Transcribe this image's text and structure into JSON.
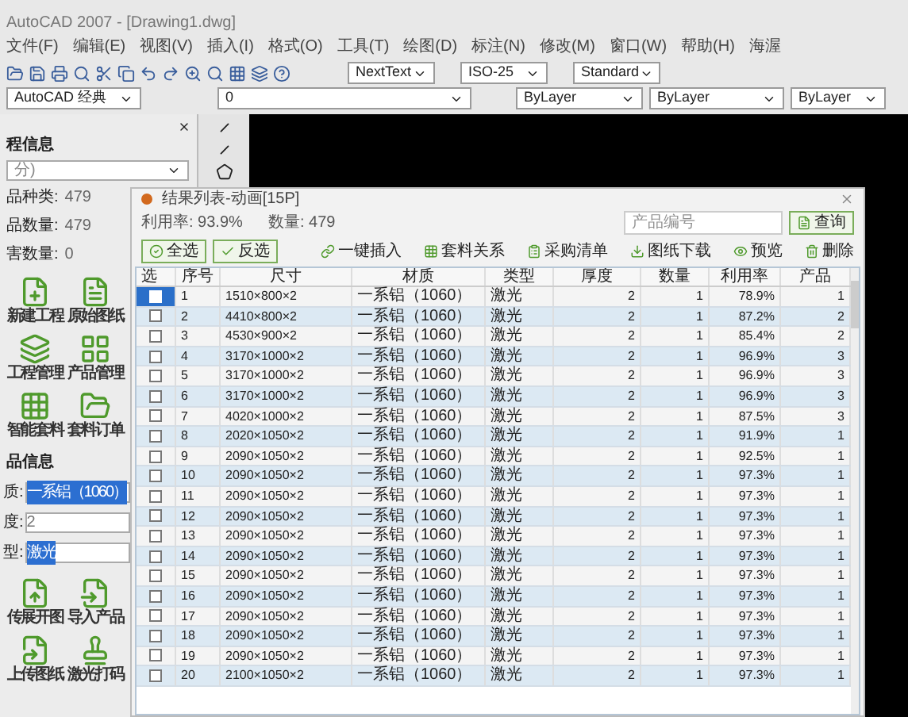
{
  "window": {
    "title": "AutoCAD 2007 - [Drawing1.dwg]"
  },
  "menu": [
    "文件(F)",
    "编辑(E)",
    "视图(V)",
    "插入(I)",
    "格式(O)",
    "工具(T)",
    "绘图(D)",
    "标注(N)",
    "修改(M)",
    "窗口(W)",
    "帮助(H)",
    "海渥"
  ],
  "toolbar": {
    "text_style": "NextText",
    "dim_style": "ISO-25",
    "table_style": "Standard",
    "workspace": "AutoCAD 经典",
    "layer": "0",
    "object_color": "ByLayer",
    "linetype": "ByLayer",
    "lineweight": "ByLayer"
  },
  "side_panel": {
    "heading": "程信息",
    "dropdown": "分)",
    "stats": [
      {
        "label": "品种类:",
        "value": "479"
      },
      {
        "label": "品数量:",
        "value": "479"
      },
      {
        "label": "害数量:",
        "value": "0"
      }
    ],
    "tools": [
      {
        "label": "新建工程"
      },
      {
        "label": "原始图纸"
      },
      {
        "label": "工程管理"
      },
      {
        "label": "产品管理"
      },
      {
        "label": "智能套料"
      },
      {
        "label": "套料订单"
      }
    ],
    "group": "品信息",
    "fields": [
      {
        "label": "质:",
        "value": "一系铝（1060）",
        "selected": true
      },
      {
        "label": "度:",
        "value": "2",
        "selected": false
      },
      {
        "label": "型:",
        "value": "激光",
        "selected": true
      }
    ],
    "tools2": [
      {
        "label": "传展开图"
      },
      {
        "label": "导入产品"
      },
      {
        "label": "上传图纸"
      },
      {
        "label": "激光打码"
      }
    ]
  },
  "dialog": {
    "title": "结果列表-动画[15P]",
    "utilization": "利用率: 93.9%",
    "count": "数量: 479",
    "search": {
      "placeholder": "产品编号"
    },
    "search_button": "查询",
    "select_buttons": [
      "全选",
      "反选"
    ],
    "actions": [
      "一键插入",
      "套料关系",
      "采购清单",
      "图纸下载",
      "预览",
      "删除"
    ],
    "check_header": "选",
    "columns": [
      "序号",
      "尺寸",
      "材质",
      "类型",
      "厚度",
      "数量",
      "利用率",
      "产品"
    ],
    "rows": [
      {
        "selected": true,
        "cells": [
          "1",
          "1510×800×2",
          "一系铝（1060）",
          "激光",
          "2",
          "1",
          "78.9%",
          "1"
        ]
      },
      {
        "selected": false,
        "cells": [
          "2",
          "4410×800×2",
          "一系铝（1060）",
          "激光",
          "2",
          "1",
          "87.2%",
          "2"
        ]
      },
      {
        "selected": false,
        "cells": [
          "3",
          "4530×900×2",
          "一系铝（1060）",
          "激光",
          "2",
          "1",
          "85.4%",
          "2"
        ]
      },
      {
        "selected": false,
        "cells": [
          "4",
          "3170×1000×2",
          "一系铝（1060）",
          "激光",
          "2",
          "1",
          "96.9%",
          "3"
        ]
      },
      {
        "selected": false,
        "cells": [
          "5",
          "3170×1000×2",
          "一系铝（1060）",
          "激光",
          "2",
          "1",
          "96.9%",
          "3"
        ]
      },
      {
        "selected": false,
        "cells": [
          "6",
          "3170×1000×2",
          "一系铝（1060）",
          "激光",
          "2",
          "1",
          "96.9%",
          "3"
        ]
      },
      {
        "selected": false,
        "cells": [
          "7",
          "4020×1000×2",
          "一系铝（1060）",
          "激光",
          "2",
          "1",
          "87.5%",
          "3"
        ]
      },
      {
        "selected": false,
        "cells": [
          "8",
          "2020×1050×2",
          "一系铝（1060）",
          "激光",
          "2",
          "1",
          "91.9%",
          "1"
        ]
      },
      {
        "selected": false,
        "cells": [
          "9",
          "2090×1050×2",
          "一系铝（1060）",
          "激光",
          "2",
          "1",
          "92.5%",
          "1"
        ]
      },
      {
        "selected": false,
        "cells": [
          "10",
          "2090×1050×2",
          "一系铝（1060）",
          "激光",
          "2",
          "1",
          "97.3%",
          "1"
        ]
      },
      {
        "selected": false,
        "cells": [
          "11",
          "2090×1050×2",
          "一系铝（1060）",
          "激光",
          "2",
          "1",
          "97.3%",
          "1"
        ]
      },
      {
        "selected": false,
        "cells": [
          "12",
          "2090×1050×2",
          "一系铝（1060）",
          "激光",
          "2",
          "1",
          "97.3%",
          "1"
        ]
      },
      {
        "selected": false,
        "cells": [
          "13",
          "2090×1050×2",
          "一系铝（1060）",
          "激光",
          "2",
          "1",
          "97.3%",
          "1"
        ]
      },
      {
        "selected": false,
        "cells": [
          "14",
          "2090×1050×2",
          "一系铝（1060）",
          "激光",
          "2",
          "1",
          "97.3%",
          "1"
        ]
      },
      {
        "selected": false,
        "cells": [
          "15",
          "2090×1050×2",
          "一系铝（1060）",
          "激光",
          "2",
          "1",
          "97.3%",
          "1"
        ]
      },
      {
        "selected": false,
        "cells": [
          "16",
          "2090×1050×2",
          "一系铝（1060）",
          "激光",
          "2",
          "1",
          "97.3%",
          "1"
        ]
      },
      {
        "selected": false,
        "cells": [
          "17",
          "2090×1050×2",
          "一系铝（1060）",
          "激光",
          "2",
          "1",
          "97.3%",
          "1"
        ]
      },
      {
        "selected": false,
        "cells": [
          "18",
          "2090×1050×2",
          "一系铝（1060）",
          "激光",
          "2",
          "1",
          "97.3%",
          "1"
        ]
      },
      {
        "selected": false,
        "cells": [
          "19",
          "2090×1050×2",
          "一系铝（1060）",
          "激光",
          "2",
          "1",
          "97.3%",
          "1"
        ]
      },
      {
        "selected": false,
        "cells": [
          "20",
          "2100×1050×2",
          "一系铝（1060）",
          "激光",
          "2",
          "1",
          "97.3%",
          "1"
        ]
      }
    ]
  }
}
